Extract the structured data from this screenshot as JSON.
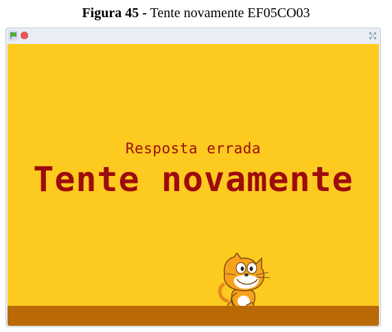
{
  "caption": {
    "figure_label": "Figura 45 -",
    "title": "Tente novamente EF05CO03"
  },
  "stage": {
    "subtitle": "Resposta errada",
    "headline": "Tente novamente",
    "background_color": "#fdca1f",
    "ground_color": "#b96906",
    "text_color": "#9c0c0c"
  },
  "controls": {
    "green_flag_icon": "green-flag-icon",
    "stop_icon": "stop-icon",
    "fullscreen_icon": "fullscreen-icon"
  },
  "sprite": {
    "icon": "scratch-cat-sprite"
  }
}
